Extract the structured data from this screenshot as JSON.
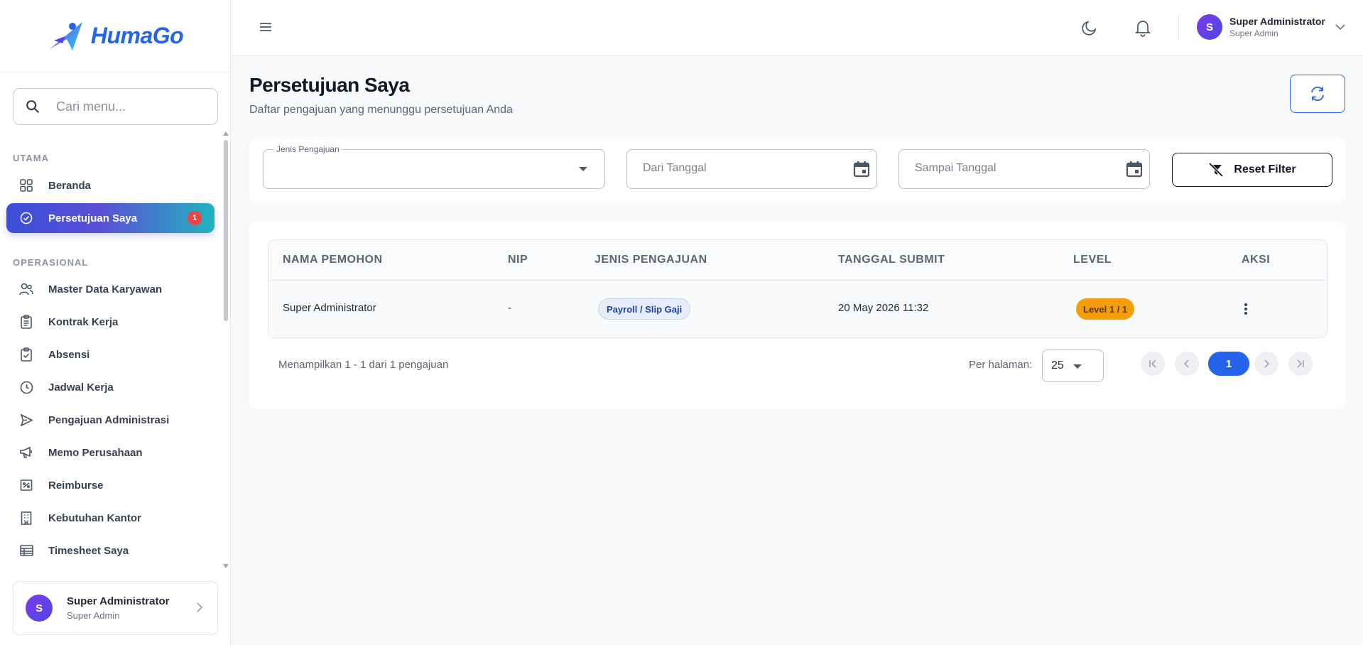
{
  "app": {
    "logo_text": "HumaGo"
  },
  "sidebar": {
    "search_placeholder": "Cari menu...",
    "sections": [
      {
        "label": "UTAMA"
      },
      {
        "label": "OPERASIONAL"
      }
    ],
    "items": [
      {
        "label": "Beranda",
        "icon": "grid-icon"
      },
      {
        "label": "Persetujuan Saya",
        "icon": "check-circle-icon",
        "active": true,
        "badge": "1"
      },
      {
        "label": "Master Data Karyawan",
        "icon": "users-icon"
      },
      {
        "label": "Kontrak Kerja",
        "icon": "clipboard-icon"
      },
      {
        "label": "Absensi",
        "icon": "clipboard-check-icon"
      },
      {
        "label": "Jadwal Kerja",
        "icon": "clock-icon"
      },
      {
        "label": "Pengajuan Administrasi",
        "icon": "send-icon"
      },
      {
        "label": "Memo Perusahaan",
        "icon": "megaphone-icon"
      },
      {
        "label": "Reimburse",
        "icon": "receipt-icon"
      },
      {
        "label": "Kebutuhan Kantor",
        "icon": "building-icon"
      },
      {
        "label": "Timesheet Saya",
        "icon": "table-icon"
      }
    ],
    "user": {
      "initial": "S",
      "name": "Super Administrator",
      "role": "Super Admin"
    }
  },
  "header": {
    "user": {
      "initial": "S",
      "name": "Super Administrator",
      "role": "Super Admin"
    }
  },
  "page": {
    "title": "Persetujuan Saya",
    "subtitle": "Daftar pengajuan yang menunggu persetujuan Anda"
  },
  "filters": {
    "type_label": "Jenis Pengajuan",
    "type_value": "",
    "from_placeholder": "Dari Tanggal",
    "to_placeholder": "Sampai Tanggal",
    "reset_label": "Reset Filter"
  },
  "table": {
    "columns": [
      "NAMA PEMOHON",
      "NIP",
      "JENIS PENGAJUAN",
      "TANGGAL SUBMIT",
      "LEVEL",
      "AKSI"
    ],
    "rows": [
      {
        "name": "Super Administrator",
        "nip": "-",
        "type": "Payroll / Slip Gaji",
        "submitted": "20 May 2026 11:32",
        "level": "Level 1 / 1"
      }
    ]
  },
  "pagination": {
    "summary": "Menampilkan 1 - 1 dari 1 pengajuan",
    "per_page_label": "Per halaman:",
    "per_page_value": "25",
    "current_page": "1"
  },
  "colors": {
    "primary": "#2563eb",
    "badge": "#ef4444",
    "level_badge": "#f59e0b"
  }
}
